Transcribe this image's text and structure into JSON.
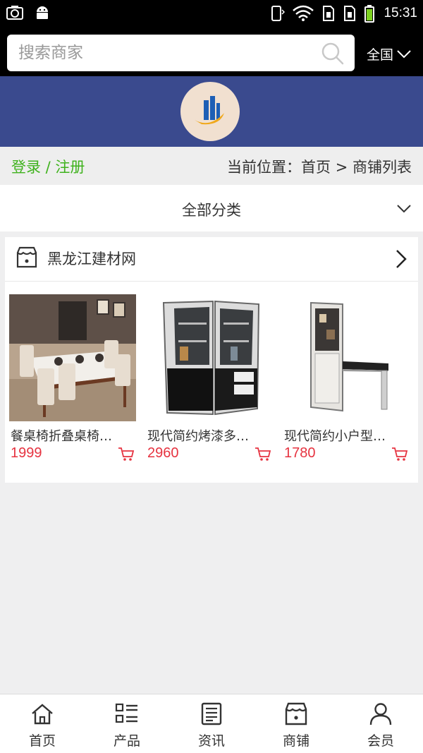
{
  "status_bar": {
    "time": "15:31"
  },
  "search": {
    "placeholder": "搜索商家",
    "value": ""
  },
  "region": {
    "label": "全国"
  },
  "breadcrumb": {
    "login_register": "登录 / 注册",
    "location": "当前位置：首页 > 商铺列表"
  },
  "category": {
    "label": "全部分类"
  },
  "shop": {
    "name": "黑龙江建材网",
    "products": [
      {
        "name": "餐桌椅折叠桌椅…",
        "price": "1999"
      },
      {
        "name": "现代简约烤漆多…",
        "price": "2960"
      },
      {
        "name": "现代简约小户型…",
        "price": "1780"
      }
    ]
  },
  "bottom_nav": [
    {
      "label": "首页",
      "icon": "home-icon"
    },
    {
      "label": "产品",
      "icon": "list-icon"
    },
    {
      "label": "资讯",
      "icon": "news-icon"
    },
    {
      "label": "商铺",
      "icon": "store-icon"
    },
    {
      "label": "会员",
      "icon": "user-icon"
    }
  ],
  "colors": {
    "banner": "#3a4a8e",
    "login_link": "#3fb21d",
    "price": "#e63340",
    "background": "#efeff0"
  }
}
